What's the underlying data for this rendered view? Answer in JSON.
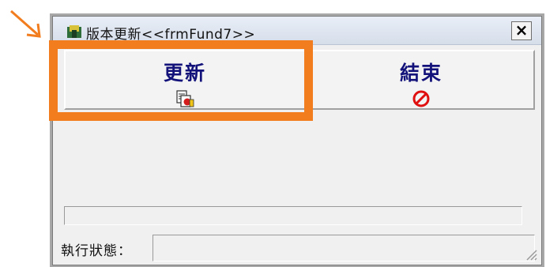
{
  "window": {
    "title": "版本更新<<frmFund7>>",
    "close_label": "×"
  },
  "buttons": {
    "update_label": "更新",
    "end_label": "結束"
  },
  "progress": {
    "value": 0
  },
  "status": {
    "label": "執行狀態：",
    "value": ""
  },
  "icons": {
    "title": "app-icon",
    "update": "document-update-icon",
    "end": "prohibited-icon",
    "close": "close-icon",
    "grip": "resize-grip-icon"
  },
  "colors": {
    "annotation": "#f27d1e",
    "button_text": "#12127a",
    "prohibited": "#e01010"
  }
}
